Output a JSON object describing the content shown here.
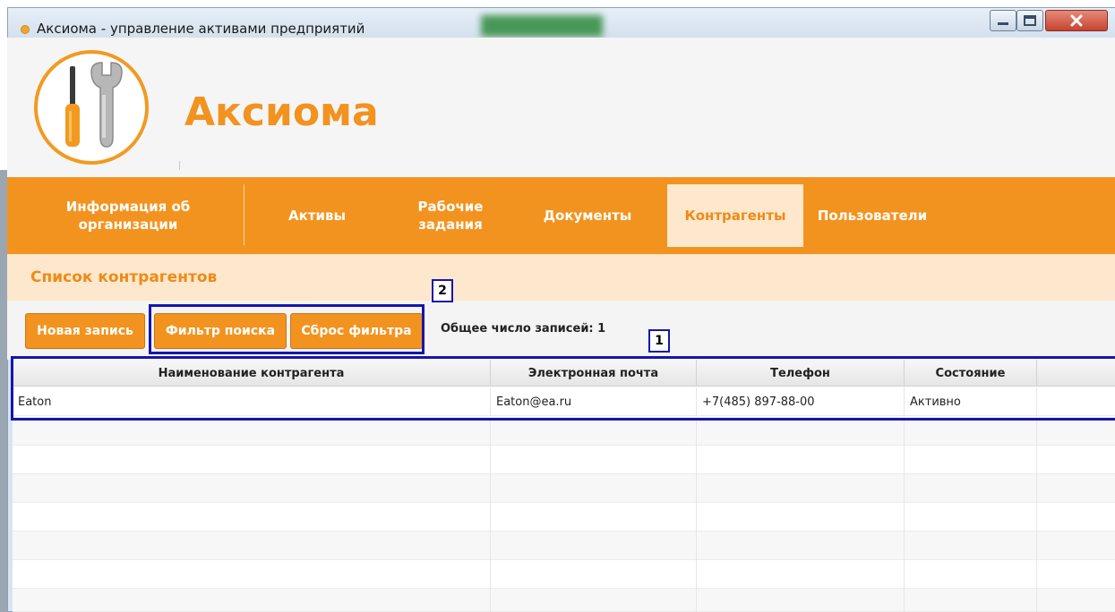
{
  "window": {
    "title": "Аксиома - управление активами предприятий",
    "colors": {
      "accent": "#f3931f",
      "accent_light": "#fde8cd",
      "callout": "#1515b0"
    }
  },
  "header": {
    "brand": "Аксиома",
    "logo_icon": "screwdriver-wrench-icon"
  },
  "nav": {
    "items": [
      {
        "label_lines": [
          "Информация об",
          "организации"
        ]
      },
      {
        "label_lines": [
          "Активы"
        ]
      },
      {
        "label_lines": [
          "Рабочие",
          "задания"
        ]
      },
      {
        "label_lines": [
          "Документы"
        ]
      },
      {
        "label_lines": [
          "Контрагенты"
        ],
        "active": true
      },
      {
        "label_lines": [
          "Пользователи"
        ]
      }
    ]
  },
  "list": {
    "title": "Список контрагентов"
  },
  "toolbar": {
    "new_record": "Новая запись",
    "search_filter": "Фильтр поиска",
    "reset_filter": "Сброс фильтра",
    "total_records": "Общее число записей: 1"
  },
  "callouts": [
    {
      "number": "1"
    },
    {
      "number": "2"
    }
  ],
  "table": {
    "columns": [
      "Наименование контрагента",
      "Электронная почта",
      "Телефон",
      "Состояние",
      ""
    ],
    "rows": [
      {
        "name": "Eaton",
        "email": "Eaton@ea.ru",
        "phone": "+7(485) 897-88-00",
        "status": "Активно",
        "extra": ""
      }
    ]
  }
}
